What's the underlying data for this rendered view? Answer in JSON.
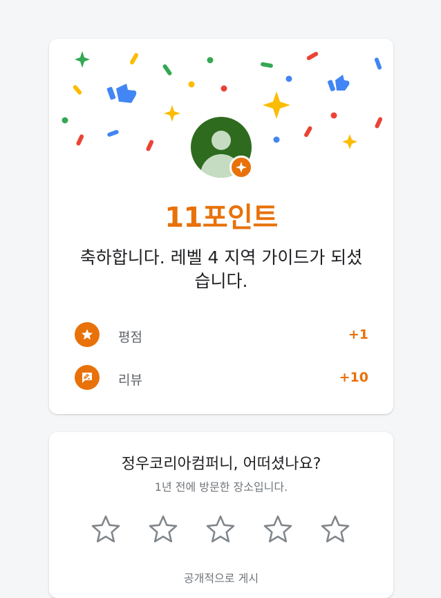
{
  "points_card": {
    "points_title": "11포인트",
    "congrats_text": "축하합니다. 레벨 4 지역 가이드가 되셨습니다.",
    "rows": [
      {
        "label": "평점",
        "value": "+1",
        "icon": "star-icon"
      },
      {
        "label": "리뷰",
        "value": "+10",
        "icon": "review-icon"
      }
    ]
  },
  "rating_card": {
    "title": "정우코리아컴퍼니, 어떠셨나요?",
    "subtitle": "1년 전에 방문한 장소입니다.",
    "star_count": 5,
    "post_label": "공개적으로 게시"
  },
  "colors": {
    "accent": "#e8710a",
    "confetti": [
      "#4285f4",
      "#ea4335",
      "#fbbc04",
      "#34a853"
    ],
    "avatar_bg": "#2f6b1f"
  }
}
